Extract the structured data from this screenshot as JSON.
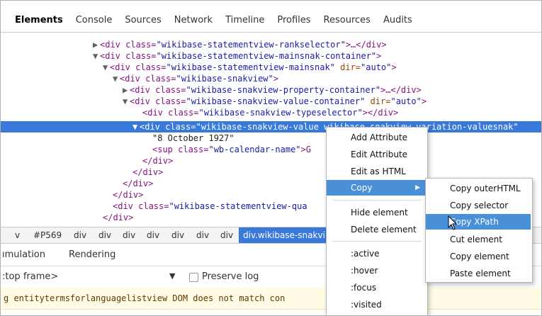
{
  "tabs": [
    "Elements",
    "Console",
    "Sources",
    "Network",
    "Timeline",
    "Profiles",
    "Resources",
    "Audits"
  ],
  "active_tab": "Elements",
  "tree": [
    {
      "arrow": "▶",
      "open": "<div class=",
      "val": "\"wikibase-statementview-rankselector\"",
      "rest": ">…</div>"
    },
    {
      "arrow": "▼",
      "open": "<div class=",
      "val": "\"wikibase-statementview-mainsnak-container\"",
      "rest": ">"
    },
    {
      "arrow": "▼",
      "open": "<div class=",
      "val": "\"wikibase-statementview-mainsnak\"",
      "attr2": " dir=",
      "val2": "\"auto\"",
      "rest": ">"
    },
    {
      "arrow": "▼",
      "open": "<div class=",
      "val": "\"wikibase-snakview\"",
      "rest": ">"
    },
    {
      "arrow": "▶",
      "open": "<div class=",
      "val": "\"wikibase-snakview-property-container\"",
      "rest": ">…</div>"
    },
    {
      "arrow": "▼",
      "open": "<div class=",
      "val": "\"wikibase-snakview-value-container\"",
      "attr2": " dir=",
      "val2": "\"auto\"",
      "rest": ">"
    },
    {
      "arrow": "",
      "open": "<div class=",
      "val": "\"wikibase-snakview-typeselector\"",
      "rest": "></div>"
    },
    {
      "arrow": "▼",
      "open": "<div class=",
      "val": "\"wikibase-snakview-value wikibase-snakview-variation-valuesnak\"",
      "rest": ""
    },
    {
      "arrow": "",
      "text": "\"8 October 1927\""
    },
    {
      "arrow": "",
      "open": "<sup class=",
      "val": "\"wb-calendar-name\"",
      "rest": ">G"
    },
    {
      "arrow": "",
      "close": "</div>"
    },
    {
      "arrow": "",
      "close": "</div>"
    },
    {
      "arrow": "",
      "close": "</div>"
    },
    {
      "arrow": "",
      "close": "</div>"
    },
    {
      "arrow": "",
      "open": "<div class=",
      "val": "\"wikibase-statementview-qua",
      "rest": ""
    },
    {
      "arrow": "",
      "close": "</div>"
    }
  ],
  "breadcrumbs": [
    "v",
    "#P569",
    "div",
    "div",
    "div",
    "div",
    "div",
    "div",
    "div"
  ],
  "breadcrumb_active": "div.wikibase-snakvi",
  "drawer_tabs": [
    "ımulation",
    "Rendering"
  ],
  "frame_select": ":top frame>",
  "preserve_log": "Preserve log",
  "warning_text": "g entitytermsforlanguagelistview DOM does not match con",
  "context_menu": {
    "items": [
      "Add Attribute",
      "Edit Attribute",
      "Edit as HTML",
      "Copy",
      "Hide element",
      "Delete element",
      ":active",
      ":hover",
      ":focus",
      ":visited"
    ],
    "highlighted": "Copy"
  },
  "copy_submenu": {
    "items": [
      "Copy outerHTML",
      "Copy selector",
      "Copy XPath",
      "Cut element",
      "Copy element",
      "Paste element"
    ],
    "highlighted": "Copy XPath"
  },
  "colors": {
    "selection": "#3879d9",
    "menu_highlight": "#4a90d9",
    "tag": "#881280",
    "attr": "#994500",
    "value": "#1a1aa6"
  }
}
